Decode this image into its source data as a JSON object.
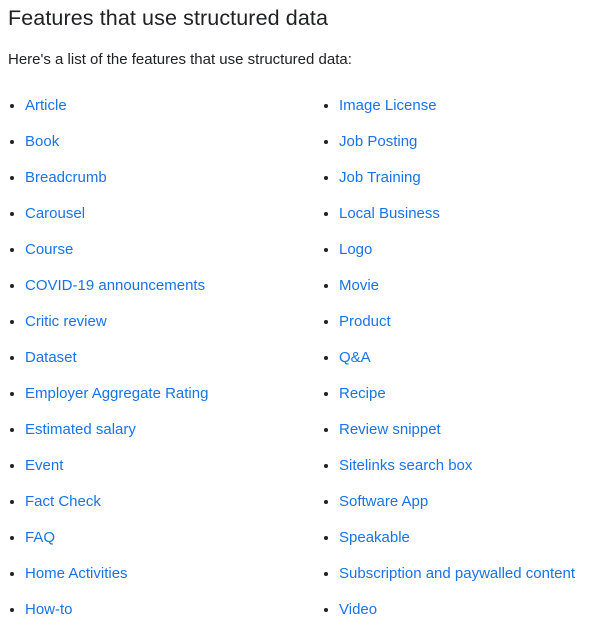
{
  "page": {
    "title": "Features that use structured data",
    "intro": "Here's a list of the features that use structured data:",
    "link_color": "#1a73e8",
    "text_color": "#202124",
    "background_color": "#ffffff",
    "bullet_icon": "bullet-dot"
  },
  "features": {
    "left_column": [
      {
        "label": "Article"
      },
      {
        "label": "Book"
      },
      {
        "label": "Breadcrumb"
      },
      {
        "label": "Carousel"
      },
      {
        "label": "Course"
      },
      {
        "label": "COVID-19 announcements"
      },
      {
        "label": "Critic review"
      },
      {
        "label": "Dataset"
      },
      {
        "label": "Employer Aggregate Rating"
      },
      {
        "label": "Estimated salary"
      },
      {
        "label": "Event"
      },
      {
        "label": "Fact Check"
      },
      {
        "label": "FAQ"
      },
      {
        "label": "Home Activities"
      },
      {
        "label": "How-to"
      }
    ],
    "right_column": [
      {
        "label": "Image License"
      },
      {
        "label": "Job Posting"
      },
      {
        "label": "Job Training"
      },
      {
        "label": "Local Business"
      },
      {
        "label": "Logo"
      },
      {
        "label": "Movie"
      },
      {
        "label": "Product"
      },
      {
        "label": "Q&A"
      },
      {
        "label": "Recipe"
      },
      {
        "label": "Review snippet"
      },
      {
        "label": "Sitelinks search box"
      },
      {
        "label": "Software App"
      },
      {
        "label": "Speakable"
      },
      {
        "label": "Subscription and paywalled content"
      },
      {
        "label": "Video"
      }
    ]
  }
}
